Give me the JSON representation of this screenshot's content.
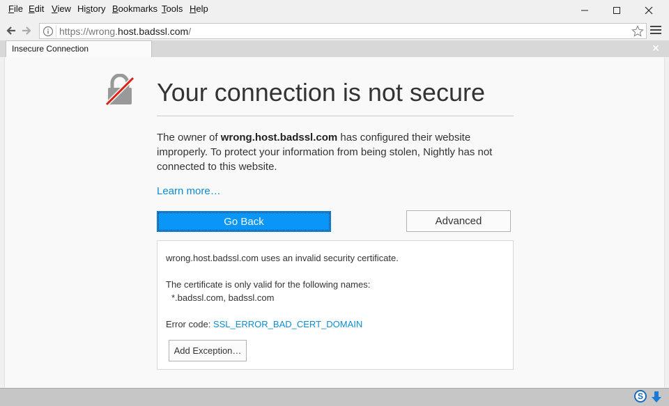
{
  "menubar": {
    "items": [
      {
        "accel": "F",
        "rest": "ile"
      },
      {
        "accel": "E",
        "rest": "dit"
      },
      {
        "accel": "V",
        "rest": "iew"
      },
      {
        "accel": "",
        "rest": "Hi",
        "accel2": "s",
        "rest2": "tory"
      },
      {
        "accel": "B",
        "rest": "ookmarks"
      },
      {
        "accel": "T",
        "rest": "ools"
      },
      {
        "accel": "H",
        "rest": "elp"
      }
    ]
  },
  "window_controls": {
    "minimize": "minimize-icon",
    "maximize": "maximize-icon",
    "close": "close-icon"
  },
  "urlbar": {
    "prefix": "https://wrong.",
    "host": "host.badssl.com",
    "suffix": "/"
  },
  "tab": {
    "title": "Insecure Connection"
  },
  "page": {
    "title": "Your connection is not secure",
    "desc_before": "The owner of ",
    "desc_host": "wrong.host.badssl.com",
    "desc_after": " has configured their website improperly. To protect your information from being stolen, Nightly has not connected to this website.",
    "learn_more": "Learn more…",
    "go_back": "Go Back",
    "advanced": "Advanced"
  },
  "advanced_panel": {
    "line1": "wrong.host.badssl.com uses an invalid security certificate.",
    "line2": "The certificate is only valid for the following names:",
    "line3": "*.badssl.com, badssl.com",
    "error_prefix": "Error code: ",
    "error_code": "SSL_ERROR_BAD_CERT_DOMAIN",
    "add_exception": "Add Exception…"
  },
  "statusbar": {
    "s_label": "S"
  },
  "colors": {
    "accent": "#0996f8",
    "link": "#0a8dd2",
    "lock_slash": "#d92215"
  }
}
